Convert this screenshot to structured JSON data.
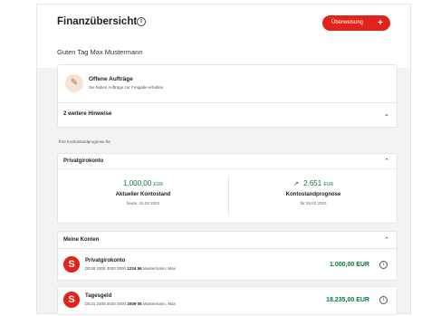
{
  "header": {
    "title": "Finanzübersicht",
    "info_glyph": "i",
    "transfer_button": "Überweisung",
    "transfer_plus": "+",
    "greeting": "Guten Tag Max Mustermann"
  },
  "orders": {
    "icon": "pen-icon",
    "icon_glyph": "✎",
    "title": "Offene Aufträge",
    "subtitle": "Sie haben Aufträge zur Freigabe erhalten",
    "more_hints": "2 weitere Hinweise"
  },
  "forecast": {
    "caption": "Ihre Kontostandprognose für",
    "account": "Privatgirokonto",
    "current": {
      "amount": "1.000,00",
      "currency": "EUR",
      "label": "Aktueller Kontostand",
      "date": "heute, 15.02.2023"
    },
    "prognosis": {
      "amount": "2.651",
      "currency": "EUR",
      "label": "Kontostandprognose",
      "date": "für 28.02.2023",
      "trend_glyph": "↗"
    }
  },
  "accounts": {
    "header": "Meine Konten",
    "logo_glyph": "S",
    "info_glyph": "i",
    "items": [
      {
        "name": "Privatgirokonto",
        "iban_prefix": "DE28 2305 3030 0000",
        "iban_bold": "1234 56",
        "owner": "Mustermann, Max",
        "balance": "1.000,00 EUR"
      },
      {
        "name": "Tagesgeld",
        "iban_prefix": "DE31 2305 3030 0000",
        "iban_bold": "2009 05",
        "owner": "Mustermann, Max",
        "balance": "18.235,00 EUR"
      }
    ]
  },
  "colors": {
    "brand_red": "#e2231a",
    "positive_green": "#0a7a3e"
  }
}
